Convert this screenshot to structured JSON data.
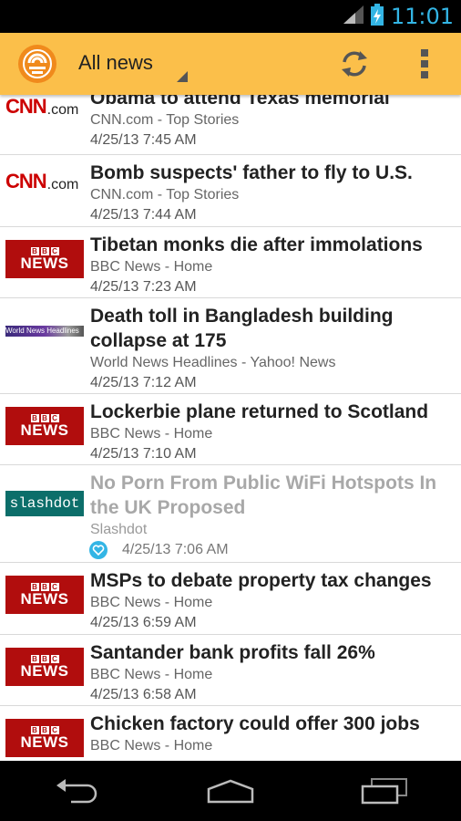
{
  "status_bar": {
    "time": "11:01"
  },
  "action_bar": {
    "spinner_label": "All news"
  },
  "articles": [
    {
      "title": "Obama to attend Texas memorial",
      "source": "CNN.com - Top Stories",
      "date": "4/25/13 7:45 AM",
      "logo": "CNN.com"
    },
    {
      "title": "Bomb suspects' father to fly to U.S.",
      "source": "CNN.com - Top Stories",
      "date": "4/25/13 7:44 AM",
      "logo": "CNN.com"
    },
    {
      "title": "Tibetan monks die after immolations",
      "source": "BBC News - Home",
      "date": "4/25/13 7:23 AM",
      "logo": "BBC NEWS"
    },
    {
      "title": "Death toll in Bangladesh building collapse at 175",
      "source": "World News Headlines - Yahoo! News",
      "date": "4/25/13 7:12 AM",
      "logo": "World News Headlines"
    },
    {
      "title": "Lockerbie plane returned to Scotland",
      "source": "BBC News - Home",
      "date": "4/25/13 7:10 AM",
      "logo": "BBC NEWS"
    },
    {
      "title": "No Porn From Public WiFi Hotspots In the UK Proposed",
      "source": "Slashdot",
      "date": "4/25/13 7:06 AM",
      "logo": "slashdot",
      "read": true,
      "favorite": true
    },
    {
      "title": "MSPs to debate property tax changes",
      "source": "BBC News - Home",
      "date": "4/25/13 6:59 AM",
      "logo": "BBC NEWS"
    },
    {
      "title": "Santander bank profits fall 26%",
      "source": "BBC News - Home",
      "date": "4/25/13 6:58 AM",
      "logo": "BBC NEWS"
    },
    {
      "title": "Chicken factory could offer 300 jobs",
      "source": "BBC News - Home",
      "date": "",
      "logo": "BBC NEWS"
    }
  ],
  "colors": {
    "action_bar": "#fbbf4a",
    "accent": "#33b5e5",
    "bbc_red": "#b10d0d",
    "cnn_red": "#cc0000"
  }
}
